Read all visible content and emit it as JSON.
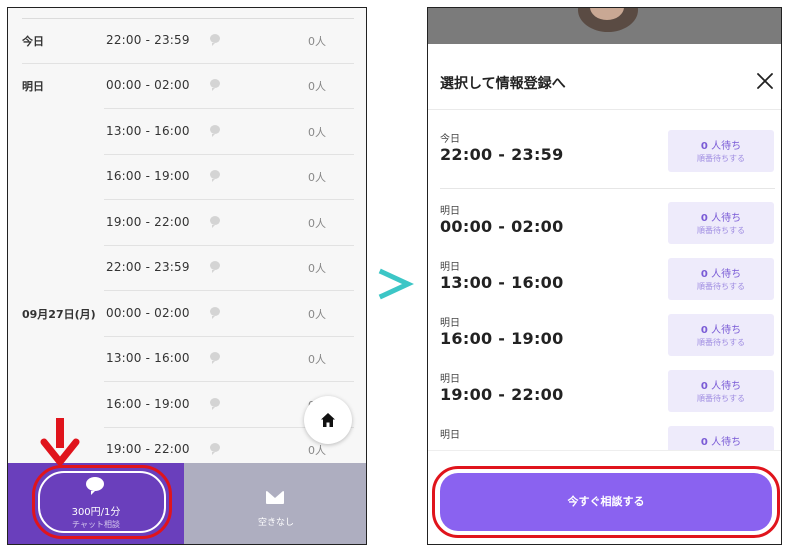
{
  "left": {
    "schedule": [
      {
        "day": "今日",
        "time": "22:00 - 23:59",
        "count": "0人"
      },
      {
        "day": "明日",
        "time": "00:00 - 02:00",
        "count": "0人"
      },
      {
        "day": "",
        "time": "13:00 - 16:00",
        "count": "0人"
      },
      {
        "day": "",
        "time": "16:00 - 19:00",
        "count": "0人"
      },
      {
        "day": "",
        "time": "19:00 - 22:00",
        "count": "0人"
      },
      {
        "day": "",
        "time": "22:00 - 23:59",
        "count": "0人"
      },
      {
        "day": "09月27日(月)",
        "time": "00:00 - 02:00",
        "count": "0人"
      },
      {
        "day": "",
        "time": "13:00 - 16:00",
        "count": "0人"
      },
      {
        "day": "",
        "time": "16:00 - 19:00",
        "count": "0人"
      },
      {
        "day": "",
        "time": "19:00 - 22:00",
        "count": "0人"
      }
    ],
    "chat_button": {
      "price": "300円/1分",
      "sub": "チャット相談"
    },
    "mail_button": {
      "label": "空きなし"
    }
  },
  "right": {
    "title": "選択して情報登録へ",
    "slots": [
      {
        "day": "今日",
        "time": "22:00 - 23:59",
        "wait_num": "0",
        "wait_text": "人待ち",
        "queue": "順番待ちする"
      },
      {
        "day": "明日",
        "time": "00:00 - 02:00",
        "wait_num": "0",
        "wait_text": "人待ち",
        "queue": "順番待ちする"
      },
      {
        "day": "明日",
        "time": "13:00 - 16:00",
        "wait_num": "0",
        "wait_text": "人待ち",
        "queue": "順番待ちする"
      },
      {
        "day": "明日",
        "time": "16:00 - 19:00",
        "wait_num": "0",
        "wait_text": "人待ち",
        "queue": "順番待ちする"
      },
      {
        "day": "明日",
        "time": "19:00 - 22:00",
        "wait_num": "0",
        "wait_text": "人待ち",
        "queue": "順番待ちする"
      },
      {
        "day": "明日",
        "time": "",
        "wait_num": "0",
        "wait_text": "人待ち",
        "queue": ""
      }
    ],
    "consult_button": "今すぐ相談する"
  },
  "colors": {
    "chat_purple": "#6a3fbc",
    "button_purple": "#8a62f0",
    "annotation_red": "#e0141c",
    "arrow_teal": "#3cc6c6"
  }
}
